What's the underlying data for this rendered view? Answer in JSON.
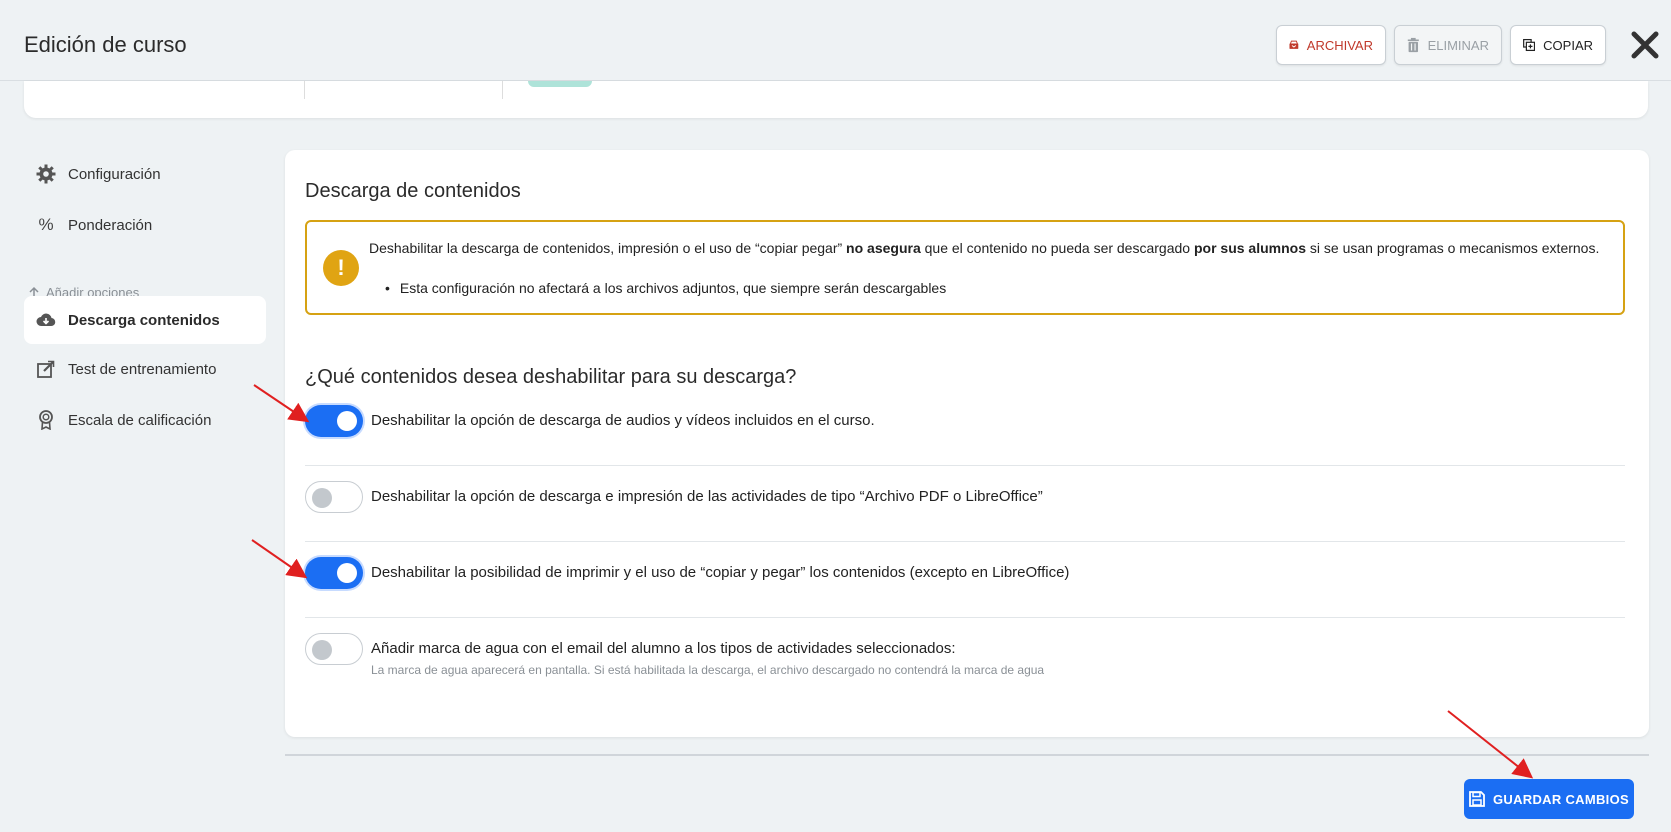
{
  "header": {
    "title": "Edición de curso",
    "archive_label": "ARCHIVAR",
    "delete_label": "ELIMINAR",
    "copy_label": "COPIAR"
  },
  "sidebar": {
    "items": [
      {
        "label": "Configuración",
        "icon": "gear-icon"
      },
      {
        "label": "Ponderación",
        "icon": "percent-icon"
      }
    ],
    "section_label": "Añadir opciones",
    "options": [
      {
        "label": "Descarga contenidos",
        "icon": "cloud-download-icon",
        "active": true
      },
      {
        "label": "Test de entrenamiento",
        "icon": "edit-square-icon",
        "active": false
      },
      {
        "label": "Escala de calificación",
        "icon": "award-icon",
        "active": false
      }
    ]
  },
  "main": {
    "title": "Descarga de contenidos",
    "warning": {
      "text_1": "Deshabilitar la descarga de contenidos, impresión o el uso de “copiar pegar” ",
      "bold_1": "no asegura",
      "text_2": " que el contenido no pueda ser descargado ",
      "bold_2": "por sus alumnos",
      "text_3": " si se usan programas o mecanismos externos.",
      "bullet": "Esta configuración no afectará a los archivos adjuntos, que siempre serán descargables"
    },
    "question": "¿Qué contenidos desea deshabilitar para su descarga?",
    "options": [
      {
        "label": "Deshabilitar la opción de descarga de audios y vídeos incluidos en el curso.",
        "enabled": true
      },
      {
        "label": "Deshabilitar la opción de descarga e impresión de las actividades de tipo “Archivo PDF o LibreOffice”",
        "enabled": false
      },
      {
        "label": "Deshabilitar la posibilidad de imprimir y el uso de “copiar y pegar” los contenidos (excepto en LibreOffice)",
        "enabled": true
      },
      {
        "label": "Añadir marca de agua con el email del alumno a los tipos de actividades seleccionados:",
        "sublabel": "La marca de agua aparecerá en pantalla. Si está habilitada la descarga, el archivo descargado no contendrá la marca de agua",
        "enabled": false
      }
    ]
  },
  "footer": {
    "save_label": "GUARDAR CAMBIOS"
  },
  "colors": {
    "accent": "#1b6ef3",
    "warning_border": "#d6a213",
    "danger": "#c0392b"
  }
}
